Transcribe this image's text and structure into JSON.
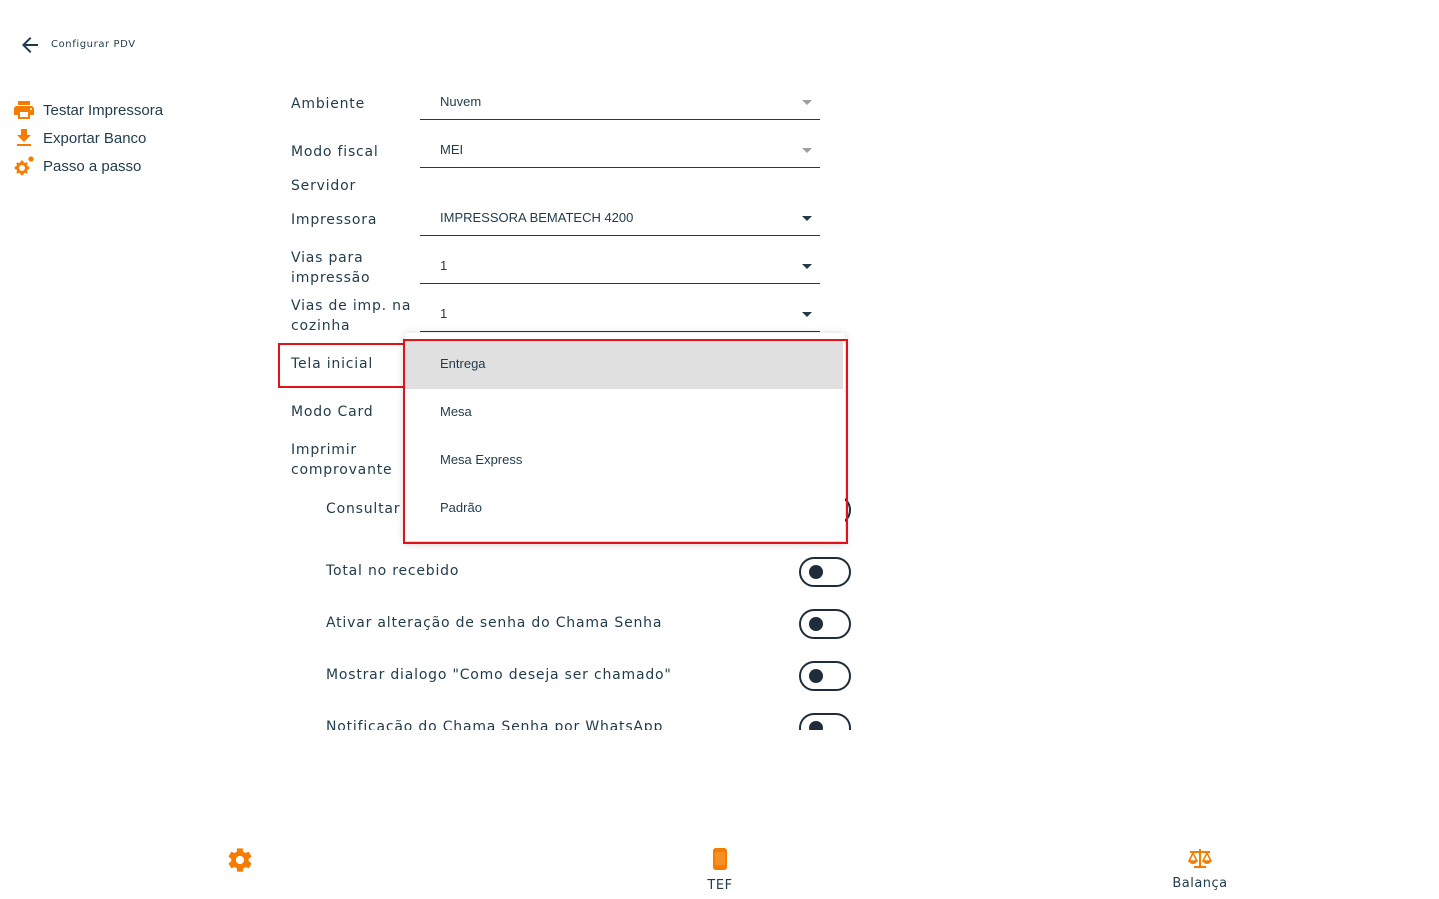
{
  "header": {
    "title": "Configurar PDV"
  },
  "sidebar": {
    "items": [
      {
        "label": "Testar Impressora",
        "icon": "printer-icon"
      },
      {
        "label": "Exportar Banco",
        "icon": "download-icon"
      },
      {
        "label": "Passo a passo",
        "icon": "gears-icon"
      }
    ]
  },
  "form": {
    "ambiente": {
      "label": "Ambiente",
      "value": "Nuvem"
    },
    "modo_fiscal": {
      "label": "Modo fiscal",
      "value": "MEI"
    },
    "servidor": {
      "label": "Servidor"
    },
    "impressora": {
      "label": "Impressora",
      "value": "IMPRESSORA BEMATECH 4200"
    },
    "vias_impressao": {
      "label_line1": "Vias para",
      "label_line2": "impressão",
      "value": "1"
    },
    "vias_cozinha": {
      "label_line1": "Vias de imp. na",
      "label_line2": "cozinha",
      "value": "1"
    },
    "tela_inicial": {
      "label": "Tela inicial"
    },
    "modo_card": {
      "label": "Modo Card"
    },
    "imprimir_comprovante": {
      "label_line1": "Imprimir",
      "label_line2": "comprovante"
    }
  },
  "toggles": [
    {
      "label": "Consultar",
      "on": false
    },
    {
      "label": "Total no recebido",
      "on": false
    },
    {
      "label": "Ativar alteração de senha do Chama Senha",
      "on": false
    },
    {
      "label": "Mostrar dialogo \"Como deseja ser chamado\"",
      "on": false
    },
    {
      "label": "Notificação do Chama Senha por WhatsApp",
      "on": false
    }
  ],
  "dropdown": {
    "options": [
      "Entrega",
      "Mesa",
      "Mesa Express",
      "Padrão"
    ],
    "selected": "Entrega"
  },
  "bottom_nav": {
    "settings": {
      "label": "",
      "icon": "gear-icon"
    },
    "tef": {
      "label": "TEF",
      "icon": "phone-icon"
    },
    "balanca": {
      "label": "Balança",
      "icon": "scale-icon"
    }
  },
  "colors": {
    "accent": "#f57c00",
    "text": "#1f3b4d",
    "highlight": "#e0121a",
    "selected_bg": "#e0e0e0"
  }
}
